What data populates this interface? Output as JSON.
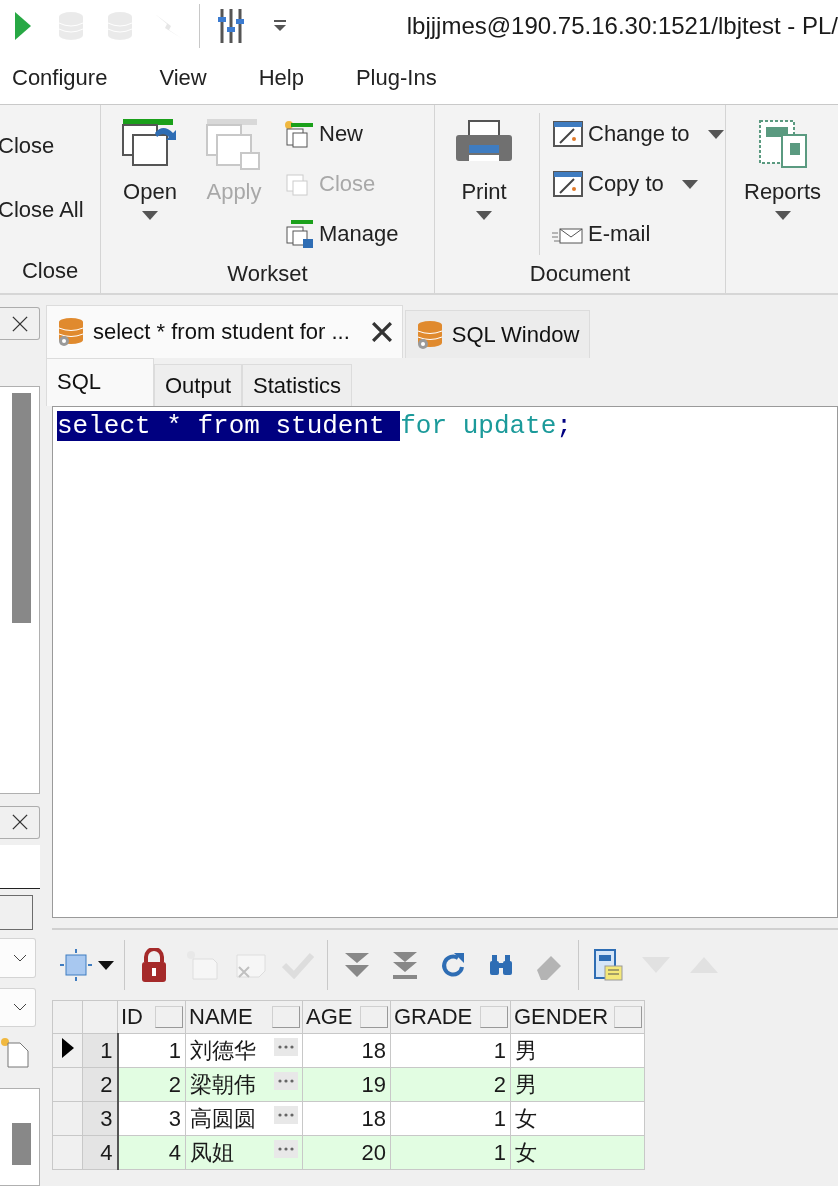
{
  "title_bar": {
    "title": "lbjjjmes@190.75.16.30:1521/lbjtest - PL/",
    "tools": [
      {
        "disabled": false
      },
      {
        "disabled": true
      },
      {
        "disabled": true
      },
      {
        "disabled": true
      },
      {
        "disabled": false
      },
      {
        "disabled": false
      }
    ]
  },
  "menu": [
    {
      "label": "Configure"
    },
    {
      "label": "View"
    },
    {
      "label": "Help"
    },
    {
      "label": "Plug-Ins"
    }
  ],
  "ribbon": {
    "groups": [
      {
        "label": "Close",
        "items": [
          {
            "label": "Close",
            "kind": "small",
            "disabled": false,
            "dropdown": false
          },
          {
            "label": "Close All",
            "kind": "small",
            "disabled": false,
            "dropdown": false
          }
        ]
      },
      {
        "label": "Workset",
        "items": [
          {
            "label": "Open",
            "kind": "large",
            "disabled": false,
            "dropdown": true
          },
          {
            "label": "Apply",
            "kind": "large",
            "disabled": true,
            "dropdown": false
          },
          {
            "label": "New",
            "kind": "small",
            "disabled": false,
            "dropdown": false
          },
          {
            "label": "Close",
            "kind": "small",
            "disabled": true,
            "dropdown": false
          },
          {
            "label": "Manage",
            "kind": "small",
            "disabled": false,
            "dropdown": false
          }
        ]
      },
      {
        "label": "Document",
        "items": [
          {
            "label": "Print",
            "kind": "large",
            "disabled": false,
            "dropdown": true
          },
          {
            "label": "Change to",
            "kind": "small",
            "disabled": false,
            "dropdown": true
          },
          {
            "label": "Copy to",
            "kind": "small",
            "disabled": false,
            "dropdown": true
          },
          {
            "label": "E-mail",
            "kind": "small",
            "disabled": false,
            "dropdown": false
          }
        ]
      },
      {
        "items": [
          {
            "label": "Reports",
            "kind": "large",
            "disabled": false,
            "dropdown": true
          }
        ]
      }
    ]
  },
  "document_tabs": [
    {
      "label": "select * from student for  ...",
      "selected": true
    },
    {
      "label": "SQL Window",
      "selected": false
    }
  ],
  "editor_tabs": [
    {
      "label": "SQL",
      "selected": true
    },
    {
      "label": "Output",
      "selected": false
    },
    {
      "label": "Statistics",
      "selected": false
    }
  ],
  "editor": {
    "segments": [
      {
        "text": "select * from student ",
        "selected": true,
        "kind": "plain"
      },
      {
        "text": "for update",
        "selected": false,
        "kind": "keyword"
      },
      {
        "text": ";",
        "selected": false,
        "kind": "punct"
      }
    ]
  },
  "result_toolbar": [
    {
      "disabled": false
    },
    {
      "disabled": false
    },
    {
      "disabled": true
    },
    {
      "disabled": true
    },
    {
      "disabled": true
    },
    {
      "disabled": false
    },
    {
      "disabled": false
    },
    {
      "disabled": false
    },
    {
      "disabled": false
    },
    {
      "disabled": false
    },
    {
      "disabled": false
    },
    {
      "disabled": true
    },
    {
      "disabled": true
    }
  ],
  "grid": {
    "columns": [
      "ID",
      "NAME",
      "AGE",
      "GRADE",
      "GENDER"
    ],
    "rows": [
      {
        "number": "1",
        "selected": true,
        "cells": [
          "1",
          "刘德华",
          "18",
          "1",
          "男"
        ]
      },
      {
        "number": "2",
        "selected": false,
        "cells": [
          "2",
          "梁朝伟",
          "19",
          "2",
          "男"
        ]
      },
      {
        "number": "3",
        "selected": false,
        "cells": [
          "3",
          "高圆圆",
          "18",
          "1",
          "女"
        ]
      },
      {
        "number": "4",
        "selected": false,
        "cells": [
          "4",
          "凤姐",
          "20",
          "1",
          "女"
        ]
      }
    ]
  }
}
